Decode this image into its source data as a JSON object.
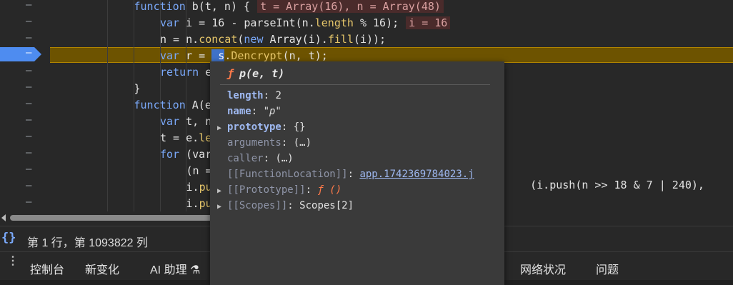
{
  "editor": {
    "lines": [
      {
        "indent": 3,
        "tokens": [
          [
            "kw",
            "function"
          ],
          [
            "pl",
            " b(t, n) {"
          ]
        ],
        "inline": "t = Array(16), n = Array(48)"
      },
      {
        "indent": 4,
        "tokens": [
          [
            "kw",
            "var"
          ],
          [
            "pl",
            " i = 16 - parseInt(n."
          ],
          [
            "fn",
            "length"
          ],
          [
            "pl",
            " % 16);"
          ]
        ],
        "inline": "i = 16"
      },
      {
        "indent": 4,
        "tokens": [
          [
            "pl",
            "n = n."
          ],
          [
            "fn",
            "concat"
          ],
          [
            "pl",
            "("
          ],
          [
            "kw",
            "new"
          ],
          [
            "pl",
            " Array(i)."
          ],
          [
            "fn",
            "fill"
          ],
          [
            "pl",
            "(i));"
          ]
        ],
        "inline": ""
      },
      {
        "indent": 4,
        "tokens": [
          [
            "kw",
            "var"
          ],
          [
            "pl",
            " r = "
          ]
        ],
        "inline": ""
      },
      {
        "indent": 4,
        "tokens": [
          [
            "kw",
            "return"
          ],
          [
            "pl",
            " e"
          ]
        ],
        "inline": ""
      },
      {
        "indent": 3,
        "tokens": [
          [
            "pl",
            "}"
          ]
        ],
        "inline": ""
      },
      {
        "indent": 3,
        "tokens": [
          [
            "kw",
            "function"
          ],
          [
            "pl",
            " A(e"
          ]
        ],
        "inline": ""
      },
      {
        "indent": 4,
        "tokens": [
          [
            "kw",
            "var"
          ],
          [
            "pl",
            " t, n"
          ]
        ],
        "inline": ""
      },
      {
        "indent": 4,
        "tokens": [
          [
            "pl",
            "t = e."
          ],
          [
            "fn",
            "le"
          ]
        ],
        "inline": ""
      },
      {
        "indent": 4,
        "tokens": [
          [
            "kw",
            "for"
          ],
          [
            "pl",
            " (var"
          ]
        ],
        "inline": ""
      },
      {
        "indent": 5,
        "tokens": [
          [
            "pl",
            "(n ="
          ]
        ],
        "inline": ""
      },
      {
        "indent": 5,
        "tokens": [
          [
            "pl",
            "i."
          ],
          [
            "fn",
            "pu"
          ]
        ],
        "inline": ""
      },
      {
        "indent": 5,
        "tokens": [
          [
            "pl",
            "i."
          ],
          [
            "fn",
            "pu"
          ]
        ],
        "inline": ""
      }
    ],
    "breakpoint_line": 4,
    "line_marker": "–",
    "decrypt_call": {
      "obj": "s",
      "dot": ".",
      "method": "Dencrypt",
      "args": "(n, t);"
    },
    "right_tail": "(i.push(n >> 18 & 7 | 240),"
  },
  "popup": {
    "f_symbol": "ƒ",
    "signature": "p(e, t)",
    "props": [
      {
        "expandable": false,
        "key": "length",
        "sep": ": ",
        "value": "2",
        "style": "num",
        "dim": false
      },
      {
        "expandable": false,
        "key": "name",
        "sep": ": ",
        "value": "\"p\"",
        "style": "str",
        "dim": false
      },
      {
        "expandable": true,
        "key": "prototype",
        "sep": ": ",
        "value": "{}",
        "style": "plain",
        "dim": false
      },
      {
        "expandable": false,
        "key": "arguments",
        "sep": ":  ",
        "value": "(…)",
        "style": "plain",
        "dim": true
      },
      {
        "expandable": false,
        "key": "caller",
        "sep": ":  ",
        "value": "(…)",
        "style": "plain",
        "dim": true
      },
      {
        "expandable": false,
        "key": "[[FunctionLocation]]",
        "sep": ": ",
        "value": "app.1742369784023.j",
        "style": "link",
        "dim": true
      },
      {
        "expandable": true,
        "key": "[[Prototype]]",
        "sep": ": ",
        "value": "ƒ ()",
        "style": "fn",
        "dim": true
      },
      {
        "expandable": true,
        "key": "[[Scopes]]",
        "sep": ": ",
        "value": "Scopes[2]",
        "style": "plain",
        "dim": true
      }
    ]
  },
  "status": {
    "braces": "{}",
    "position": "第 1 行，第 1093822 列"
  },
  "tabs": {
    "menu": "⋮",
    "items": [
      {
        "label": "控制台",
        "name": "tab-console"
      },
      {
        "label": "新变化",
        "name": "tab-whats-new"
      },
      {
        "label": "AI 助理 ⚗",
        "name": "tab-ai-assistant"
      },
      {
        "label": "网络状况",
        "name": "tab-network-conditions"
      },
      {
        "label": "问题",
        "name": "tab-issues"
      }
    ]
  },
  "colors": {
    "breakpoint": "#4e8cf0",
    "highlight": "#6d5300",
    "keyword": "#7aa8f8",
    "method": "#e6c66a"
  }
}
